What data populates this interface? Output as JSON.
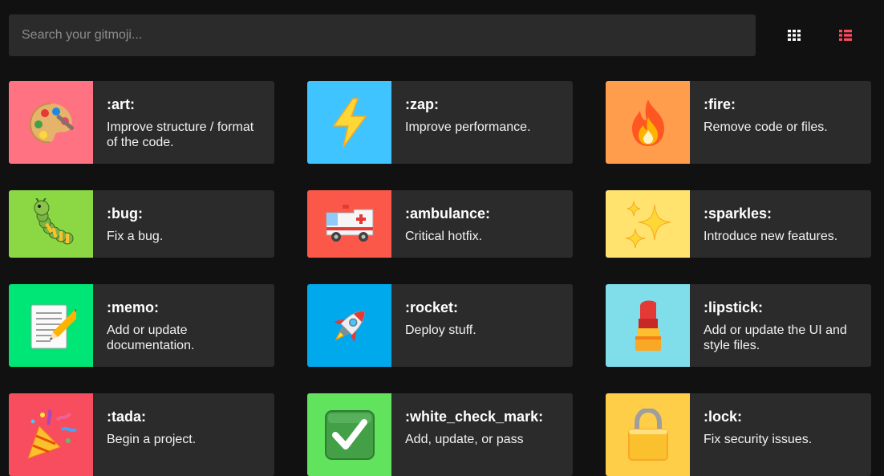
{
  "search": {
    "placeholder": "Search your gitmoji..."
  },
  "cards": [
    {
      "code": ":art:",
      "description": "Improve structure / format of the code.",
      "emoji": "palette-emoji",
      "color": "#ff7281"
    },
    {
      "code": ":zap:",
      "description": "Improve performance.",
      "emoji": "lightning-emoji",
      "color": "#40c4ff"
    },
    {
      "code": ":fire:",
      "description": "Remove code or files.",
      "emoji": "fire-emoji",
      "color": "#ff9d4d"
    },
    {
      "code": ":bug:",
      "description": "Fix a bug.",
      "emoji": "bug-emoji",
      "color": "#8cd844"
    },
    {
      "code": ":ambulance:",
      "description": "Critical hotfix.",
      "emoji": "ambulance-emoji",
      "color": "#fb584a"
    },
    {
      "code": ":sparkles:",
      "description": "Introduce new features.",
      "emoji": "sparkles-emoji",
      "color": "#ffe36e"
    },
    {
      "code": ":memo:",
      "description": "Add or update documentation.",
      "emoji": "memo-emoji",
      "color": "#00e676"
    },
    {
      "code": ":rocket:",
      "description": "Deploy stuff.",
      "emoji": "rocket-emoji",
      "color": "#00a8ec"
    },
    {
      "code": ":lipstick:",
      "description": "Add or update the UI and style files.",
      "emoji": "lipstick-emoji",
      "color": "#80deea"
    },
    {
      "code": ":tada:",
      "description": "Begin a project.",
      "emoji": "party-popper-emoji",
      "color": "#f74d5f"
    },
    {
      "code": ":white_check_mark:",
      "description": "Add, update, or pass",
      "emoji": "check-mark-emoji",
      "color": "#62e35d"
    },
    {
      "code": ":lock:",
      "description": "Fix security issues.",
      "emoji": "lock-emoji",
      "color": "#ffce49"
    }
  ]
}
